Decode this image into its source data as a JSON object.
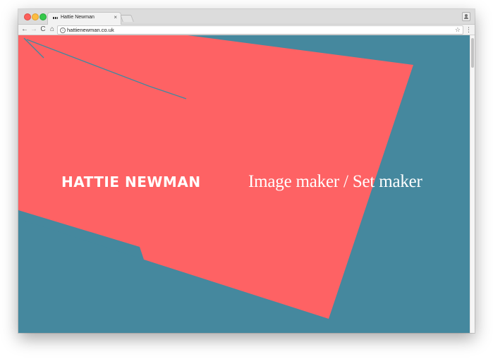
{
  "browser": {
    "tab_title": "Hattie Newman",
    "tab_close": "×",
    "url": "hattienewman.co.uk",
    "nav": {
      "back": "←",
      "forward": "→",
      "reload": "C",
      "home": "⌂"
    },
    "info": "i",
    "star": "☆",
    "menu": "⋮"
  },
  "page": {
    "brand": "HATTIE NEWMAN",
    "tagline": "Image maker / Set maker"
  },
  "colors": {
    "background": "#45889e",
    "shape": "#fe6264",
    "text": "#ffffff"
  }
}
